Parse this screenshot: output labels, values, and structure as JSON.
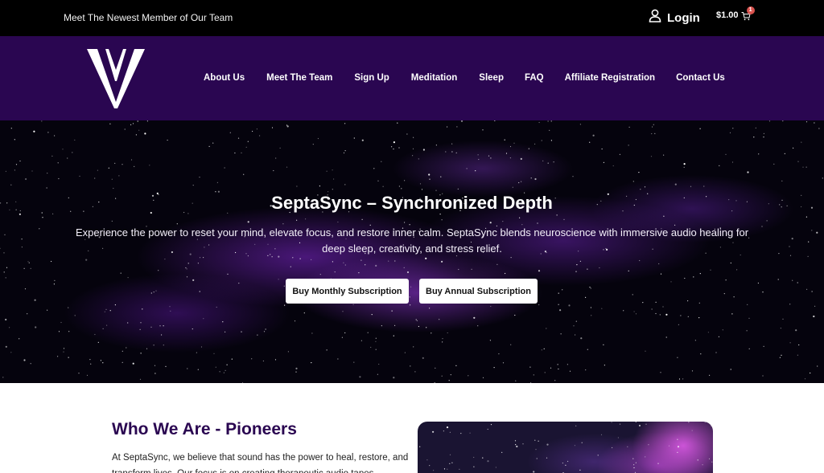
{
  "topbar": {
    "announcement": "Meet The Newest Member of Our Team",
    "login_label": "Login",
    "login_icon": "user-icon",
    "cart_amount": "$1.00",
    "cart_icon": "cart-icon",
    "cart_count": "1"
  },
  "navbar": {
    "logo": "V",
    "items": [
      {
        "label": "About Us"
      },
      {
        "label": "Meet The Team"
      },
      {
        "label": "Sign Up"
      },
      {
        "label": "Meditation"
      },
      {
        "label": "Sleep"
      },
      {
        "label": "FAQ"
      },
      {
        "label": "Affiliate Registration"
      },
      {
        "label": "Contact Us"
      }
    ]
  },
  "hero": {
    "title": "SeptaSync – Synchronized Depth",
    "description": "Experience the power to reset your mind, elevate focus, and restore inner calm. SeptaSync blends neuroscience with immersive audio healing for deep sleep, creativity, and stress relief.",
    "buttons": {
      "monthly": "Buy Monthly Subscription",
      "annual": "Buy Annual Subscription"
    }
  },
  "about": {
    "heading": "Who We Are - Pioneers",
    "text": "At SeptaSync, we believe that sound has the power to heal, restore, and transform lives. Our focus is on creating therapeutic audio tapes"
  },
  "colors": {
    "nav_background": "#2a0651",
    "topbar_background": "#000000",
    "heading_color": "#2a0651",
    "badge_color": "#d9534f"
  }
}
